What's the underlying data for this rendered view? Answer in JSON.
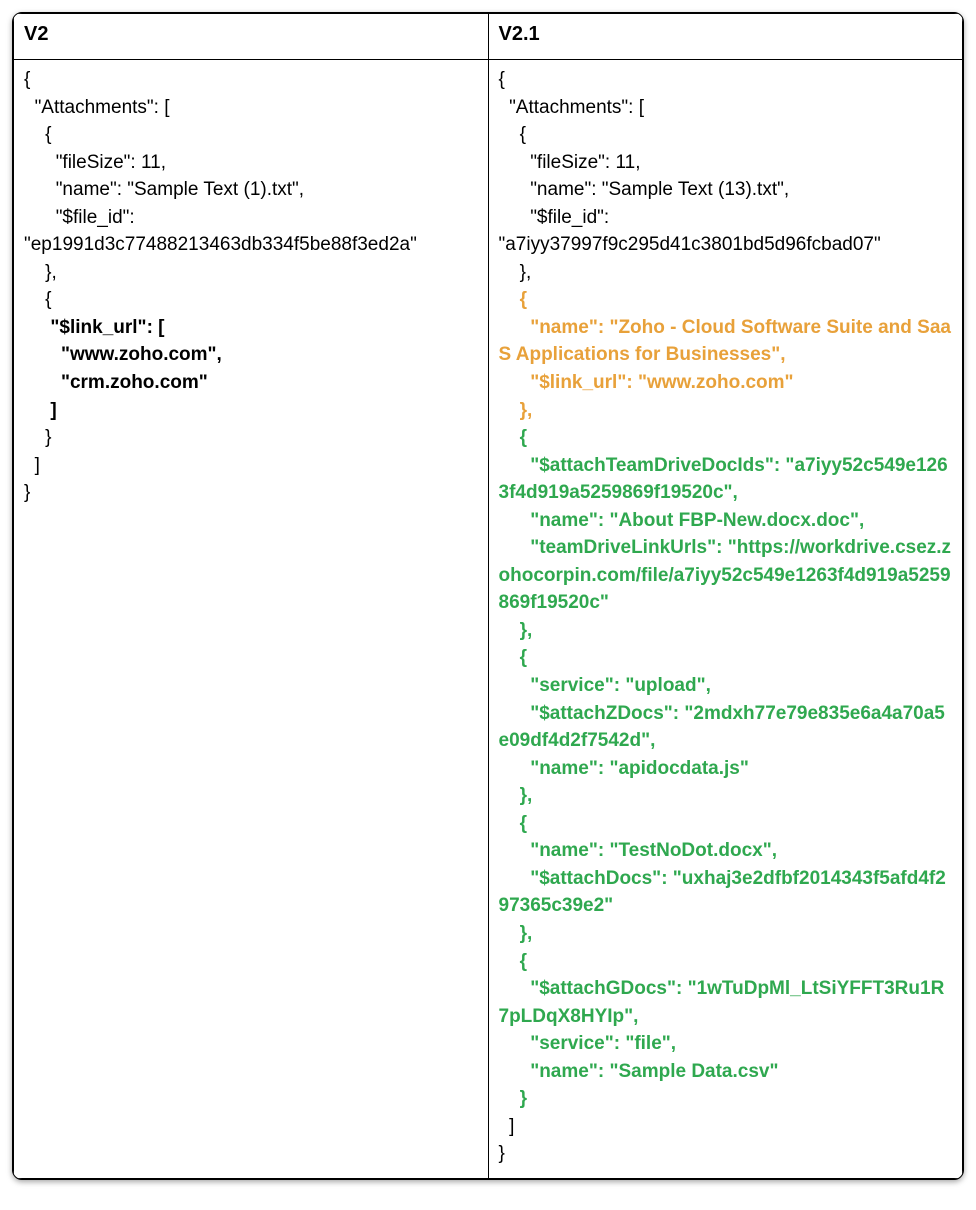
{
  "headers": {
    "left": "V2",
    "right": "V2.1"
  },
  "left": {
    "l01": "{",
    "l02": "  \"Attachments\": [",
    "l03": "    {",
    "l04": "      \"fileSize\": 11,",
    "l05": "      \"name\": \"Sample Text (1).txt\",",
    "l06": "      \"$file_id\":",
    "l07": "\"ep1991d3c77488213463db334f5be88f3ed2a\"",
    "l08": "    },",
    "l09": "    {",
    "l10": "     \"$link_url\": [",
    "l11": "       \"www.zoho.com\",",
    "l12": "       \"crm.zoho.com\"",
    "l13": "     ]",
    "l14": "    }",
    "l15": "  ]",
    "l16": "}"
  },
  "right": {
    "r01": "{",
    "r02": "  \"Attachments\": [",
    "r03": "    {",
    "r04": "      \"fileSize\": 11,",
    "r05": "      \"name\": \"Sample Text (13).txt\",",
    "r06": "      \"$file_id\":",
    "r07": "\"a7iyy37997f9c295d41c3801bd5d96fcbad07\"",
    "r08": "    },",
    "r09": "    {",
    "r10": "      \"name\": \"Zoho - Cloud Software Suite and SaaS Applications for Businesses\",",
    "r11": "      \"$link_url\": \"www.zoho.com\"",
    "r12": "    },",
    "r13": "    {",
    "r14": "      \"$attachTeamDriveDocIds\": \"a7iyy52c549e1263f4d919a5259869f19520c\",",
    "r15": "      \"name\": \"About FBP-New.docx.doc\",",
    "r16": "      \"teamDriveLinkUrls\": \"https://workdrive.csez.zohocorpin.com/file/a7iyy52c549e1263f4d919a5259869f19520c\"",
    "r17": "    },",
    "r18": "    {",
    "r19": "      \"service\": \"upload\",",
    "r20": "      \"$attachZDocs\": \"2mdxh77e79e835e6a4a70a5e09df4d2f7542d\",",
    "r21": "      \"name\": \"apidocdata.js\"",
    "r22": "    },",
    "r23": "    {",
    "r24": "      \"name\": \"TestNoDot.docx\",",
    "r25": "      \"$attachDocs\": \"uxhaj3e2dfbf2014343f5afd4f297365c39e2\"",
    "r26": "    },",
    "r27": "    {",
    "r28": "      \"$attachGDocs\": \"1wTuDpMl_LtSiYFFT3Ru1R7pLDqX8HYIp\",",
    "r29": "      \"service\": \"file\",",
    "r30": "      \"name\": \"Sample Data.csv\"",
    "r31": "    }",
    "r32": "  ]",
    "r33": "}"
  }
}
